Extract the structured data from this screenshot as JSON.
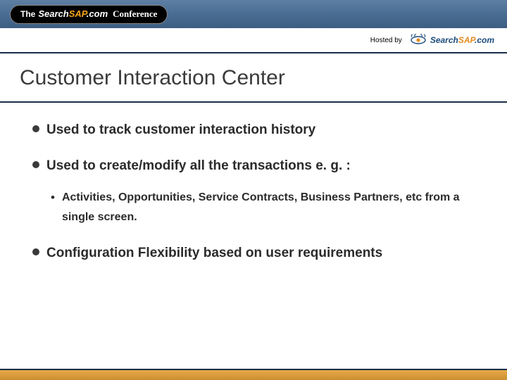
{
  "banner": {
    "the": "The",
    "search": "Search",
    "sap": "SAP",
    "com": ".com",
    "conference": "Conference"
  },
  "hosted": {
    "label": "Hosted by",
    "logo_search": "Search",
    "logo_sap": "SAP",
    "logo_com": ".com"
  },
  "title": "Customer Interaction Center",
  "bullets": [
    {
      "level": 1,
      "text": "Used to track customer interaction history"
    },
    {
      "level": 1,
      "text": "Used to create/modify all the transactions e. g. :"
    },
    {
      "level": 2,
      "text": "Activities, Opportunities, Service Contracts, Business Partners, etc from a single screen."
    },
    {
      "level": 1,
      "text": "Configuration Flexibility based on user requirements"
    }
  ]
}
